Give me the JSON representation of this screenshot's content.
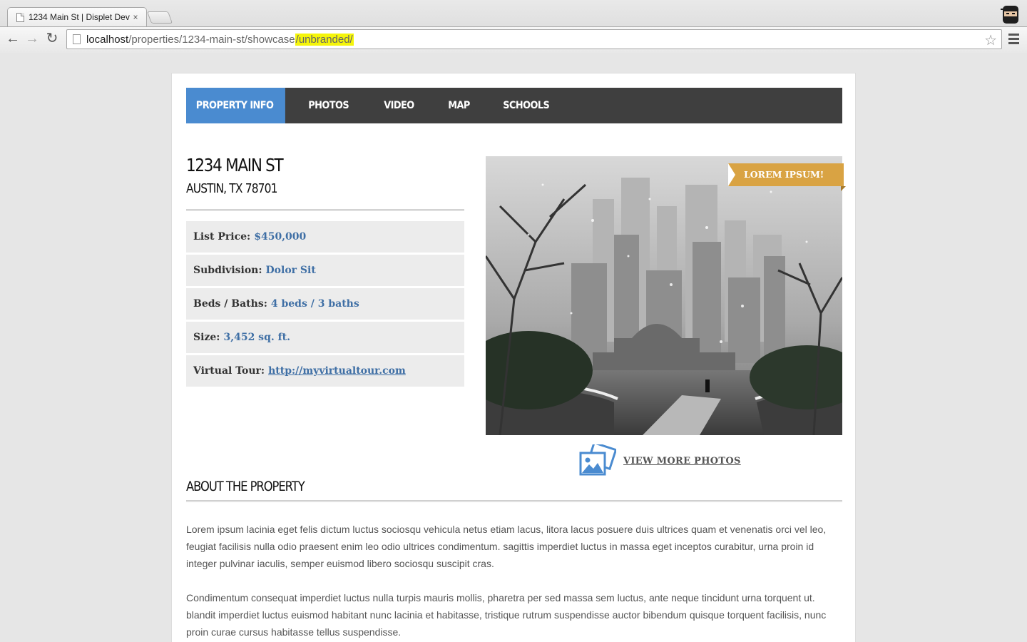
{
  "browser": {
    "tab_title": "1234 Main St | Displet Dev",
    "tab_close": "×",
    "url_host": "localhost",
    "url_path": "/properties/1234-main-st/showcase",
    "url_highlight": "/unbranded/"
  },
  "nav": {
    "items": [
      "PROPERTY INFO",
      "PHOTOS",
      "VIDEO",
      "MAP",
      "SCHOOLS"
    ],
    "active_index": 0,
    "active_color": "#4a8bd0"
  },
  "property": {
    "street": "1234 MAIN ST",
    "city_state_zip": "AUSTIN, TX 78701",
    "details": [
      {
        "label": "List Price:",
        "value": "$450,000"
      },
      {
        "label": "Subdivision:",
        "value": "Dolor Sit"
      },
      {
        "label": "Beds / Baths:",
        "value": "4 beds / 3 baths"
      },
      {
        "label": "Size:",
        "value": "3,452 sq. ft."
      },
      {
        "label": "Virtual Tour:",
        "value": "http://myvirtualtour.com"
      }
    ]
  },
  "photo": {
    "ribbon_text": "LOREM IPSUM!",
    "ribbon_color": "#d9a343",
    "view_more_label": "VIEW MORE PHOTOS"
  },
  "about": {
    "title": "ABOUT THE PROPERTY",
    "paragraphs": [
      "Lorem ipsum lacinia eget felis dictum luctus sociosqu vehicula netus etiam lacus, litora lacus posuere duis ultrices quam et venenatis orci vel leo, feugiat facilisis nulla odio praesent enim leo odio ultrices condimentum. sagittis imperdiet luctus in massa eget inceptos curabitur, urna proin id integer pulvinar iaculis, semper euismod libero sociosqu suscipit cras.",
      "Condimentum consequat imperdiet luctus nulla turpis mauris mollis, pharetra per sed massa sem luctus, ante neque tincidunt urna torquent ut. blandit imperdiet luctus euismod habitant nunc lacinia et habitasse, tristique rutrum suspendisse auctor bibendum quisque torquent facilisis, nunc proin curae cursus habitasse tellus suspendisse."
    ]
  }
}
